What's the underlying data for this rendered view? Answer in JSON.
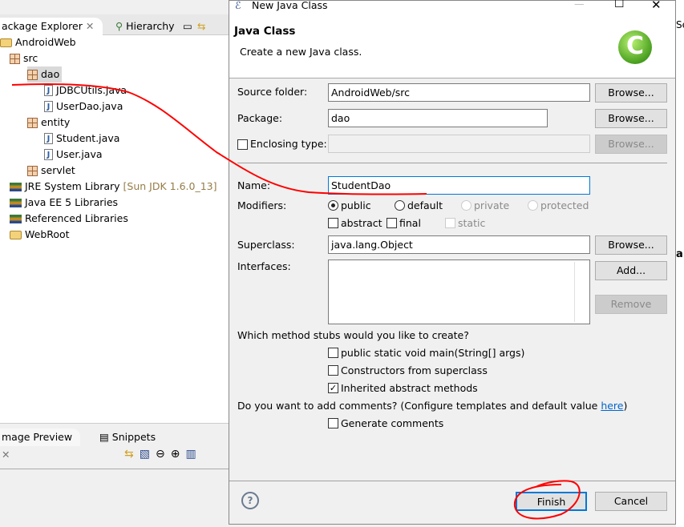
{
  "explorer": {
    "tabs": [
      "ackage Explorer",
      "Hierarchy"
    ],
    "tree": [
      {
        "label": "AndroidWeb",
        "icon": "project-icon"
      },
      {
        "label": "src",
        "icon": "source-folder-icon"
      },
      {
        "label": "dao",
        "icon": "package-icon"
      },
      {
        "label": "JDBCUtils.java",
        "icon": "java-file-icon"
      },
      {
        "label": "UserDao.java",
        "icon": "java-file-icon"
      },
      {
        "label": "entity",
        "icon": "package-icon"
      },
      {
        "label": "Student.java",
        "icon": "java-file-icon"
      },
      {
        "label": "User.java",
        "icon": "java-file-icon"
      },
      {
        "label": "servlet",
        "icon": "package-icon"
      },
      {
        "label": "JRE System Library",
        "suffix": "[Sun JDK 1.6.0_13]",
        "icon": "library-icon"
      },
      {
        "label": "Java EE 5 Libraries",
        "icon": "library-icon"
      },
      {
        "label": "Referenced Libraries",
        "icon": "library-icon"
      },
      {
        "label": "WebRoot",
        "icon": "folder-icon"
      }
    ]
  },
  "bottom_panel": {
    "tabs": [
      "mage Preview",
      "Snippets"
    ]
  },
  "dialog": {
    "title": "New Java Class",
    "heading": "Java Class",
    "description": "Create a new Java class.",
    "source_folder": {
      "label": "Source folder:",
      "value": "AndroidWeb/src",
      "browse": "Browse..."
    },
    "package": {
      "label": "Package:",
      "value": "dao",
      "browse": "Browse..."
    },
    "enclosing": {
      "label": "Enclosing type:",
      "value": "",
      "browse": "Browse...",
      "checked": false
    },
    "name": {
      "label": "Name:",
      "value": "StudentDao"
    },
    "modifiers": {
      "label": "Modifiers:",
      "options": [
        "public",
        "default",
        "private",
        "protected"
      ],
      "selected": "public",
      "abstract": "abstract",
      "final": "final",
      "static": "static"
    },
    "superclass": {
      "label": "Superclass:",
      "value": "java.lang.Object",
      "browse": "Browse..."
    },
    "interfaces": {
      "label": "Interfaces:",
      "add": "Add...",
      "remove": "Remove"
    },
    "stubs": {
      "question": "Which method stubs would you like to create?",
      "options": [
        {
          "label": "public static void main(String[] args)",
          "checked": false
        },
        {
          "label": "Constructors from superclass",
          "checked": false
        },
        {
          "label": "Inherited abstract methods",
          "checked": true
        }
      ]
    },
    "comments": {
      "question": "Do you want to add comments? (Configure templates and default value ",
      "link": "here",
      "close": ")",
      "generate": "Generate comments",
      "checked": false
    },
    "finish": "Finish",
    "cancel": "Cancel",
    "accent": "#0078d7",
    "annotation_color": "#ff0000"
  },
  "background_right": {
    "text1": "Se",
    "text2": "a"
  }
}
